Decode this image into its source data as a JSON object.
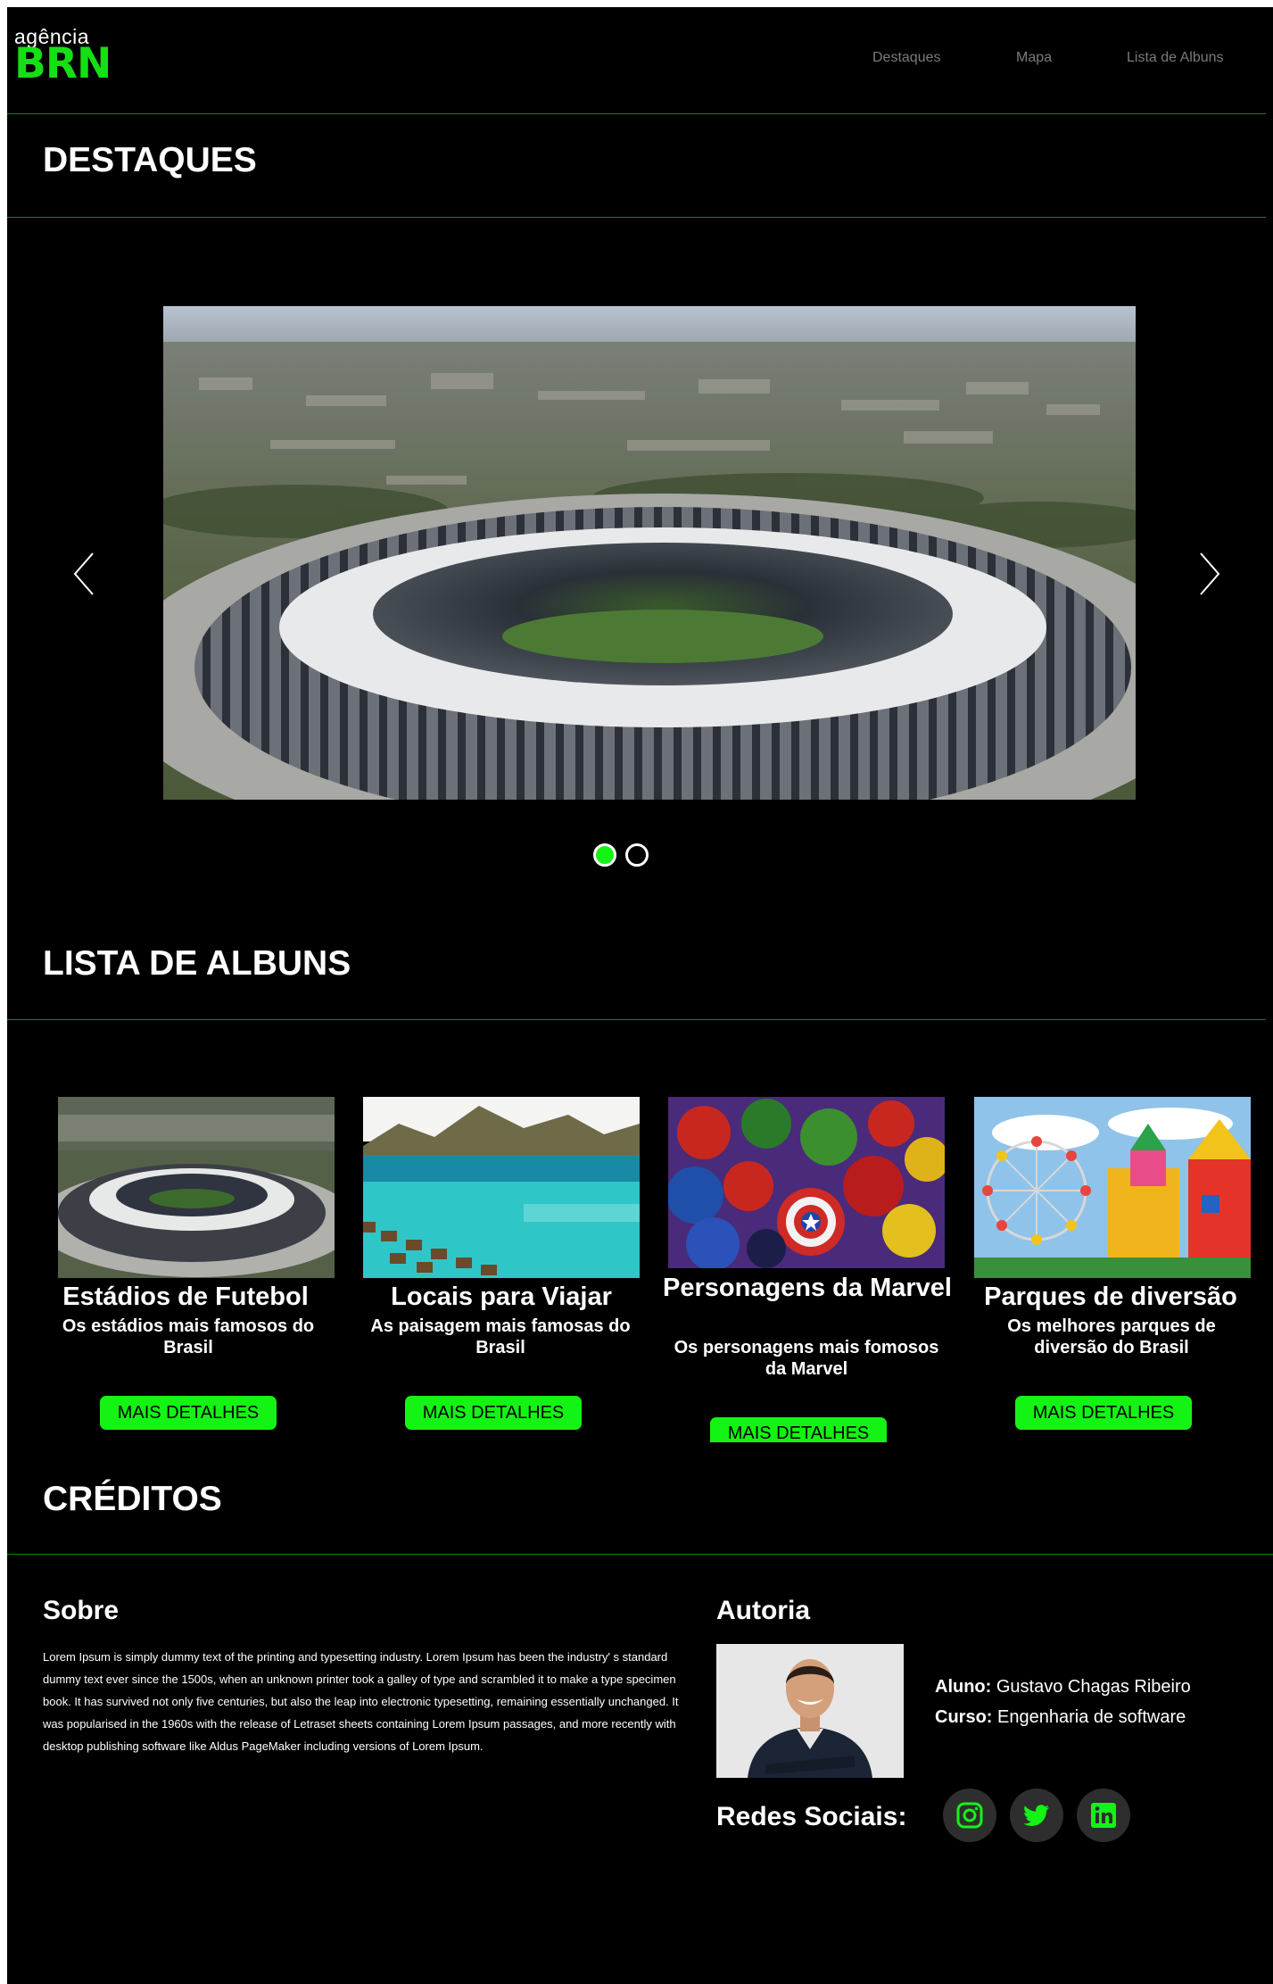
{
  "logo": {
    "small": "agência",
    "big": "BRN"
  },
  "nav": {
    "destaques": "Destaques",
    "mapa": "Mapa",
    "lista": "Lista de Albuns"
  },
  "sections": {
    "destaques": "DESTAQUES",
    "albuns": "LISTA DE ALBUNS",
    "creditos": "CRÉDITOS"
  },
  "carousel": {
    "active_index": 0,
    "slide_count": 2
  },
  "albums": [
    {
      "title": "Estádios de Futebol",
      "subtitle": "Os estádios mais famosos do Brasil",
      "button": "MAIS DETALHES"
    },
    {
      "title": "Locais para Viajar",
      "subtitle": "As paisagem mais famosas do Brasil",
      "button": "MAIS DETALHES"
    },
    {
      "title": "Personagens da Marvel",
      "subtitle": "Os personagens mais fomosos da Marvel",
      "button": "MAIS DETALHES"
    },
    {
      "title": "Parques de diversão",
      "subtitle": "Os melhores parques de diversão do Brasil",
      "button": "MAIS DETALHES"
    }
  ],
  "credits": {
    "sobre_title": "Sobre",
    "sobre_text": "Lorem Ipsum is simply dummy text of the printing and typesetting industry. Lorem Ipsum has been the industry' s standard dummy text ever since the 1500s, when an unknown printer took a galley of type and scrambled it to make a type specimen book. It has survived not only five centuries, but also the leap into electronic typesetting, remaining essentially unchanged. It was popularised in the 1960s with the release of Letraset sheets containing Lorem Ipsum passages, and more recently with desktop publishing software like Aldus PageMaker including versions of Lorem Ipsum.",
    "autoria_title": "Autoria",
    "aluno_label": "Aluno:",
    "aluno_value": "Gustavo Chagas Ribeiro",
    "curso_label": "Curso:",
    "curso_value": "Engenharia de software",
    "redes_title": "Redes Sociais:"
  },
  "colors": {
    "accent": "#14f414",
    "background": "#000000",
    "rule": "#0b8a0b",
    "nav": "#7a7a7a",
    "social_bg": "#2e2e2e"
  },
  "icons": {
    "prev": "chevron-left-icon",
    "next": "chevron-right-icon",
    "social": [
      "instagram-icon",
      "twitter-icon",
      "linkedin-icon"
    ]
  }
}
